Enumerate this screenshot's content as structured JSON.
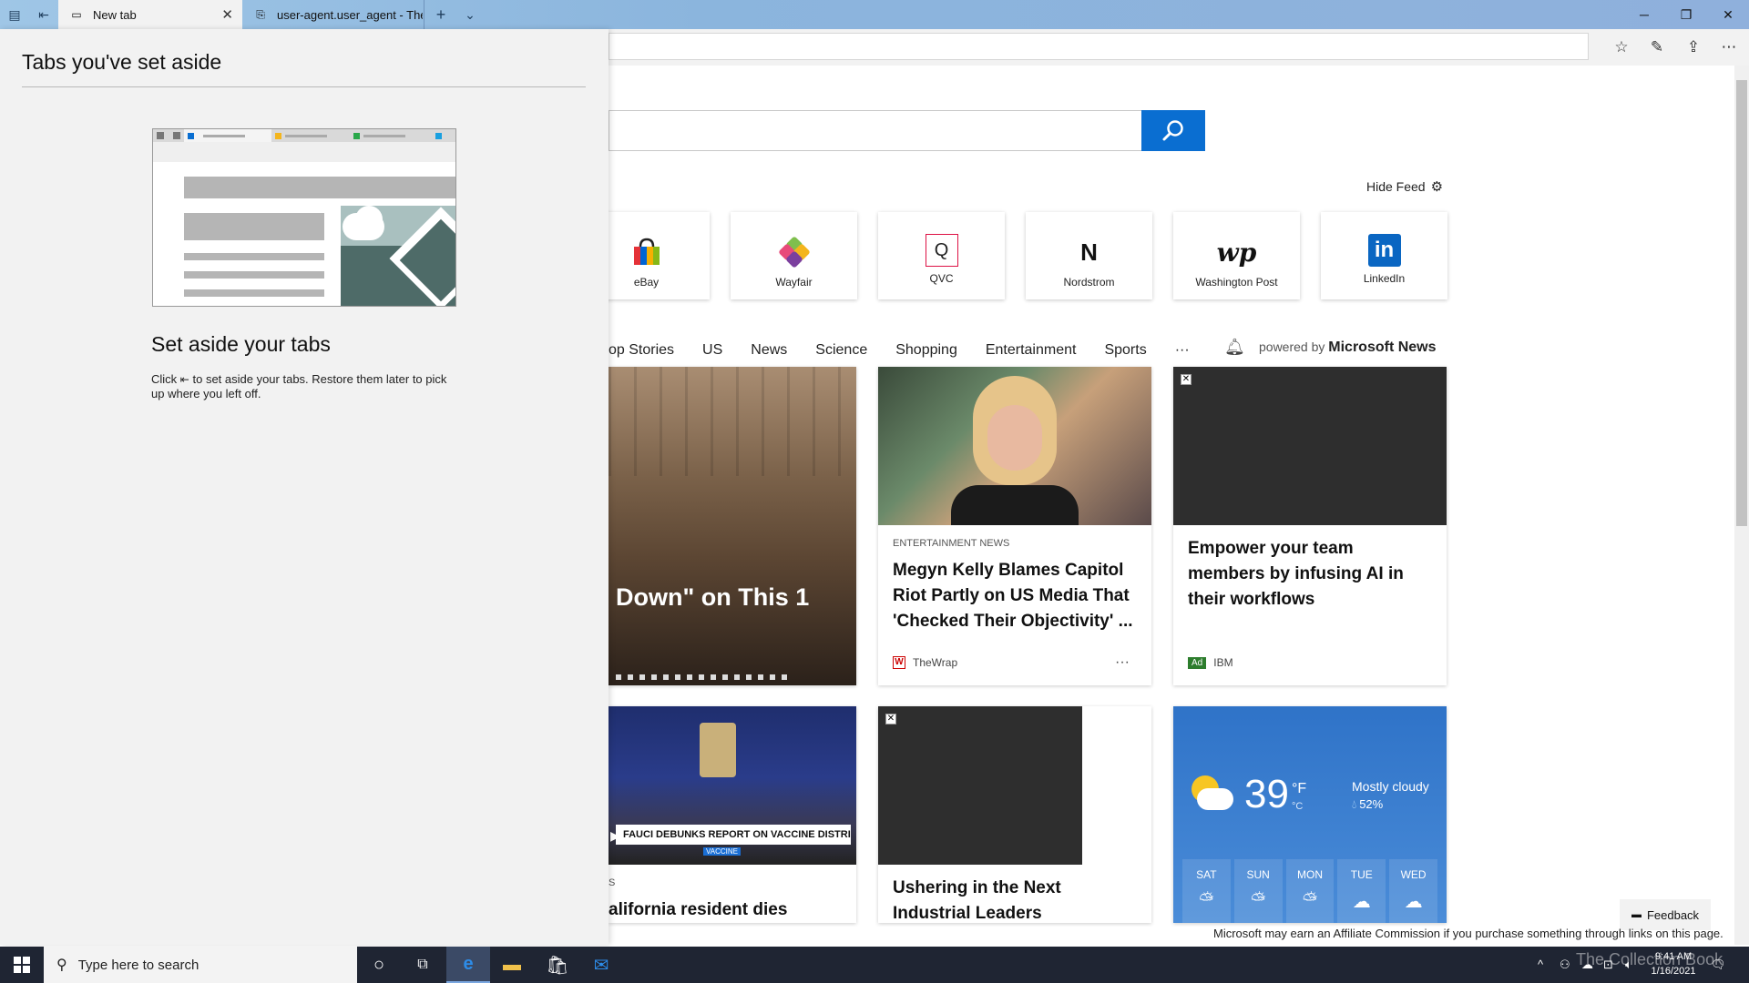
{
  "tabs": [
    {
      "label": "New tab",
      "active": true
    },
    {
      "label": "user-agent.user_agent - The",
      "active": false
    }
  ],
  "page": {
    "hide_feed": "Hide Feed",
    "tiles": [
      {
        "name": "eBay",
        "icon": "ebay-bag-icon"
      },
      {
        "name": "Wayfair",
        "icon": "wayfair-icon"
      },
      {
        "name": "QVC",
        "logo": "Q"
      },
      {
        "name": "Nordstrom",
        "logo": "N"
      },
      {
        "name": "Washington Post",
        "logo": "wp"
      },
      {
        "name": "LinkedIn",
        "logo": "in"
      }
    ],
    "categories": [
      "op Stories",
      "US",
      "News",
      "Science",
      "Shopping",
      "Entertainment",
      "Sports",
      "···"
    ],
    "powered_by": "powered by",
    "powered_brand": "Microsoft News",
    "cards": {
      "story1_overlay": "Down\" on This 1",
      "megyn": {
        "category": "ENTERTAINMENT NEWS",
        "headline": "Megyn Kelly Blames Capitol Riot Partly on US Media That 'Checked Their Objectivity' ...",
        "source": "TheWrap",
        "more": "···"
      },
      "ibm": {
        "headline": "Empower your team members by infusing AI in their workflows",
        "ad": "Ad",
        "source": "IBM"
      },
      "fauci": {
        "caption": "FAUCI DEBUNKS REPORT ON VACCINE DISTRIBUTION",
        "chyron_small": "VACCINE",
        "cat_fragment": "s",
        "headline": "alifornia resident dies"
      },
      "ushering": {
        "headline": "Ushering in the Next Industrial Leaders"
      },
      "weather": {
        "temp": "39",
        "unit_f": "°F",
        "unit_c": "°C",
        "condition": "Mostly cloudy",
        "precip": "52%",
        "days": [
          "SAT",
          "SUN",
          "MON",
          "TUE",
          "WED"
        ]
      }
    },
    "affiliate": "Microsoft may earn an Affiliate Commission if you purchase something through links on this page.",
    "feedback": "Feedback"
  },
  "panel": {
    "title": "Tabs you've set aside",
    "heading": "Set aside your tabs",
    "desc_before": "Click",
    "desc_after": "to set aside your tabs. Restore them later to pick up where you left off."
  },
  "taskbar": {
    "search_placeholder": "Type here to search",
    "time": "9:41 AM",
    "date": "1/16/2021",
    "watermark": "The Collection Book"
  },
  "colors": {
    "accent": "#0a6ed1",
    "panel_bg": "#f2f2f2",
    "taskbar_bg": "#1f2533",
    "weather_bg": "#3a7fcf"
  }
}
